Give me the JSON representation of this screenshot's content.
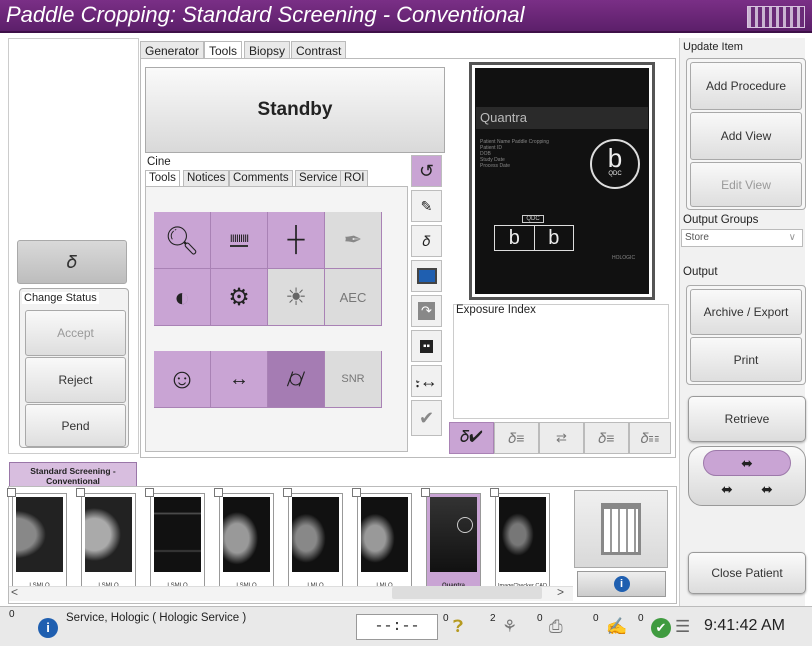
{
  "title": "Paddle Cropping:  Standard Screening - Conventional",
  "tabs": [
    {
      "label": "Generator"
    },
    {
      "label": "Tools"
    },
    {
      "label": "Biopsy"
    },
    {
      "label": "Contrast"
    }
  ],
  "standby": "Standby",
  "cine": "Cine",
  "subtabs": [
    {
      "label": "Tools"
    },
    {
      "label": "Notices"
    },
    {
      "label": "Comments"
    },
    {
      "label": "Service"
    },
    {
      "label": "ROI"
    }
  ],
  "change_status": {
    "label": "Change Status",
    "accept": "Accept",
    "reject": "Reject",
    "pend": "Pend"
  },
  "exposure_index": "Exposure Index",
  "preview": {
    "brand": "Quantra",
    "field_labels": [
      "Patient Name",
      "Patient ID",
      "DOB",
      "Study Date",
      "Process Date"
    ],
    "field_values": [
      "Paddle Cropping",
      "",
      "",
      "",
      ""
    ],
    "big_letter": "b",
    "qdc": "QDC",
    "small_b1": "b",
    "small_b2": "b",
    "hologic": "HOLOGIC"
  },
  "right": {
    "update_item": "Update Item",
    "add_procedure": "Add Procedure",
    "add_view": "Add View",
    "edit_view": "Edit View",
    "output_groups": "Output Groups",
    "store": "Store",
    "output": "Output",
    "archive_export": "Archive / Export",
    "print": "Print",
    "retrieve": "Retrieve",
    "close_patient": "Close Patient"
  },
  "procedure_tab": "Standard Screening - Conventional",
  "thumbnails": [
    {
      "caption": "LSMLO"
    },
    {
      "caption": "LSMLO"
    },
    {
      "caption": "LSMLO"
    },
    {
      "caption": "LSMLO"
    },
    {
      "caption": "LMLO"
    },
    {
      "caption": "LMLO"
    },
    {
      "caption": "Quantra"
    },
    {
      "caption": "ImageChecker CAD"
    }
  ],
  "status_bar": {
    "user": "Service, Hologic ( Hologic Service )",
    "timer": "--:--",
    "count1": "0",
    "count2": "2",
    "count3": "0",
    "count4": "0",
    "count5": "0",
    "time": "9:41:42 AM",
    "left_digit": "0"
  },
  "scroll": {
    "left": "<",
    "right": ">"
  },
  "colors": {
    "accent": "#c9a4d4",
    "title_bar": "#6a2778",
    "info_blue": "#1f5fb0"
  }
}
